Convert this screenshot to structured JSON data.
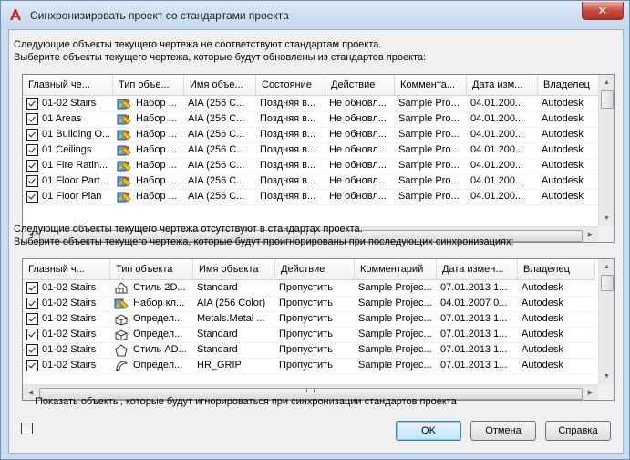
{
  "window": {
    "title": "Синхронизировать проект со стандартами проекта",
    "close_label": "✕"
  },
  "top_section": {
    "line1": "Следующие объекты текущего чертежа не соответствуют стандартам проекта.",
    "line2": "Выберите объекты текущего чертежа, которые будут обновлены из стандартов проекта:",
    "columns": [
      "Главный че...",
      "Тип объе...",
      "Имя объе...",
      "Состояние",
      "Действие",
      "Коммента...",
      "Дата изм...",
      "Владелец"
    ],
    "rows": [
      {
        "checked": true,
        "icon": "stairs-icon",
        "main": "01-02 Stairs",
        "type_icon": "tool-palette-icon",
        "type": "Набор ...",
        "name": "AIA (256 C...",
        "state": "Поздняя в...",
        "action": "Не обновл...",
        "comment": "Sample Pro...",
        "date": "04.01.200...",
        "owner": "Autodesk"
      },
      {
        "checked": true,
        "icon": "stairs-icon",
        "main": "01 Areas",
        "type_icon": "tool-palette-icon",
        "type": "Набор ...",
        "name": "AIA (256 C...",
        "state": "Поздняя в...",
        "action": "Не обновл...",
        "comment": "Sample Pro...",
        "date": "04.01.200...",
        "owner": "Autodesk"
      },
      {
        "checked": true,
        "icon": "stairs-icon",
        "main": "01 Building O...",
        "type_icon": "tool-palette-icon",
        "type": "Набор ...",
        "name": "AIA (256 C...",
        "state": "Поздняя в...",
        "action": "Не обновл...",
        "comment": "Sample Pro...",
        "date": "04.01.200...",
        "owner": "Autodesk"
      },
      {
        "checked": true,
        "icon": "ceiling-icon",
        "main": "01 Ceilings",
        "type_icon": "tool-palette-icon",
        "type": "Набор ...",
        "name": "AIA (256 C...",
        "state": "Поздняя в...",
        "action": "Не обновл...",
        "comment": "Sample Pro...",
        "date": "04.01.200...",
        "owner": "Autodesk"
      },
      {
        "checked": true,
        "icon": "ceiling-icon",
        "main": "01 Fire Ratin...",
        "type_icon": "tool-palette-icon",
        "type": "Набор ...",
        "name": "AIA (256 C...",
        "state": "Поздняя в...",
        "action": "Не обновл...",
        "comment": "Sample Pro...",
        "date": "04.01.200...",
        "owner": "Autodesk"
      },
      {
        "checked": true,
        "icon": "stairs-icon",
        "main": "01 Floor Part...",
        "type_icon": "tool-palette-icon",
        "type": "Набор ...",
        "name": "AIA (256 C...",
        "state": "Поздняя в...",
        "action": "Не обновл...",
        "comment": "Sample Pro...",
        "date": "04.01.200...",
        "owner": "Autodesk"
      },
      {
        "checked": true,
        "icon": "stairs-icon",
        "main": "01 Floor Plan",
        "type_icon": "tool-palette-icon",
        "type": "Набор ...",
        "name": "AIA (256 C...",
        "state": "Поздняя в...",
        "action": "Не обновл...",
        "comment": "Sample Pro...",
        "date": "04.01.200...",
        "owner": "Autodesk"
      }
    ]
  },
  "bottom_section": {
    "line1": "Следующие объекты текущего чертежа отсутствуют в стандартах проекта.",
    "line2": "Выберите объекты текущего чертежа, которые будут проигнорированы при последующих синхронизациях:",
    "columns": [
      "Главный ч...",
      "Тип объекта",
      "Имя объекта",
      "Действие",
      "Комментарий",
      "Дата измен...",
      "Владелец"
    ],
    "rows": [
      {
        "checked": true,
        "icon": "stairs-icon",
        "main": "01-02 Stairs",
        "type_icon": "stair-style-icon",
        "type": "Стиль 2D...",
        "name": "Standard",
        "action": "Пропустить",
        "comment": "Sample Projec...",
        "date": "07.01.2013 1...",
        "owner": "Autodesk"
      },
      {
        "checked": true,
        "icon": "stairs-icon",
        "main": "01-02 Stairs",
        "type_icon": "layer-key-icon",
        "type": "Набор кл...",
        "name": "AIA (256 Color)",
        "action": "Пропустить",
        "comment": "Sample Projec...",
        "date": "04.01.2007 0...",
        "owner": "Autodesk"
      },
      {
        "checked": true,
        "icon": "stairs-icon",
        "main": "01-02 Stairs",
        "type_icon": "material-icon",
        "type": "Определ...",
        "name": "Metals.Metal ...",
        "action": "Пропустить",
        "comment": "Sample Projec...",
        "date": "07.01.2013 1...",
        "owner": "Autodesk"
      },
      {
        "checked": true,
        "icon": "stairs-icon",
        "main": "01-02 Stairs",
        "type_icon": "material-icon",
        "type": "Определ...",
        "name": "Standard",
        "action": "Пропустить",
        "comment": "Sample Projec...",
        "date": "07.01.2013 1...",
        "owner": "Autodesk"
      },
      {
        "checked": true,
        "icon": "stairs-icon",
        "main": "01-02 Stairs",
        "type_icon": "pentagon-style-icon",
        "type": "Стиль AD...",
        "name": "Standard",
        "action": "Пропустить",
        "comment": "Sample Projec...",
        "date": "07.01.2013 1...",
        "owner": "Autodesk"
      },
      {
        "checked": true,
        "icon": "stairs-icon",
        "main": "01-02 Stairs",
        "type_icon": "grip-icon",
        "type": "Определ...",
        "name": "HR_GRIP",
        "action": "Пропустить",
        "comment": "Sample Projec...",
        "date": "07.01.2013 1...",
        "owner": "Autodesk"
      }
    ]
  },
  "show_ignored_label": "Показать объекты, которые будут игнорироваться при синхронизации стандартов проекта",
  "buttons": {
    "ok": "OK",
    "cancel": "Отмена",
    "help": "Справка"
  },
  "colors": {
    "title_bg": "#c9dcf0",
    "close_red": "#c8473a",
    "default_button": "#bee6fd"
  }
}
